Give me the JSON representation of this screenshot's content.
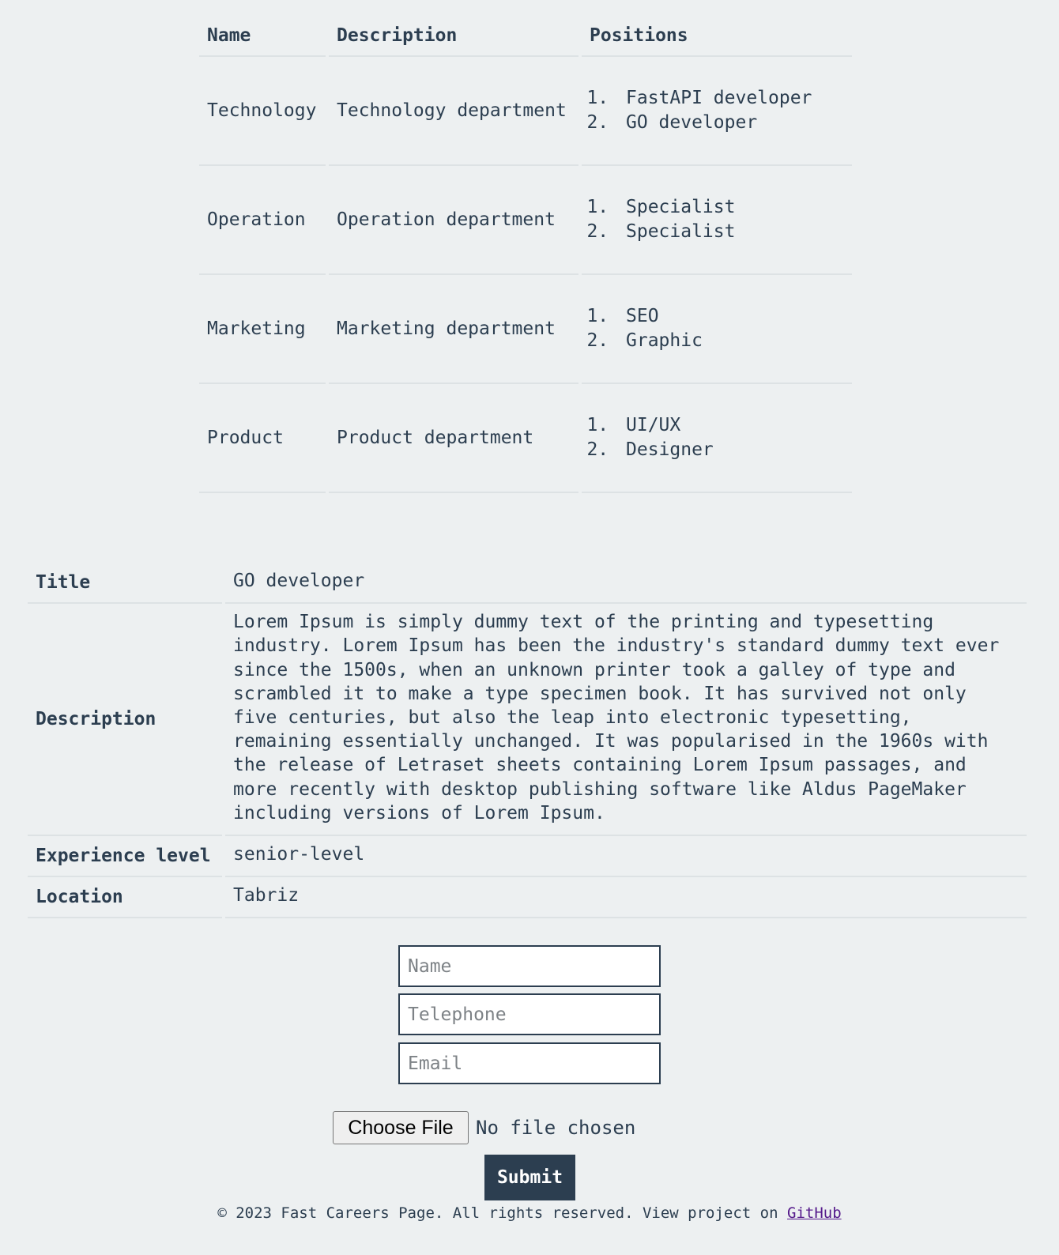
{
  "departments": {
    "headers": {
      "name": "Name",
      "description": "Description",
      "positions": "Positions"
    },
    "rows": [
      {
        "name": "Technology",
        "description": "Technology department",
        "positions": [
          "FastAPI developer",
          "GO developer"
        ]
      },
      {
        "name": "Operation",
        "description": "Operation department",
        "positions": [
          "Specialist",
          "Specialist"
        ]
      },
      {
        "name": "Marketing",
        "description": "Marketing department",
        "positions": [
          "SEO",
          "Graphic"
        ]
      },
      {
        "name": "Product",
        "description": "Product department",
        "positions": [
          "UI/UX",
          "Designer"
        ]
      }
    ]
  },
  "job": {
    "title_label": "Title",
    "title_value": "GO developer",
    "description_label": "Description",
    "description_value": "Lorem Ipsum is simply dummy text of the printing and typesetting industry. Lorem Ipsum has been the industry's standard dummy text ever since the 1500s, when an unknown printer took a galley of type and scrambled it to make a type specimen book. It has survived not only five centuries, but also the leap into electronic typesetting, remaining essentially unchanged. It was popularised in the 1960s with the release of Letraset sheets containing Lorem Ipsum passages, and more recently with desktop publishing software like Aldus PageMaker including versions of Lorem Ipsum.",
    "experience_label": "Experience level",
    "experience_value": "senior-level",
    "location_label": "Location",
    "location_value": "Tabriz"
  },
  "form": {
    "name_placeholder": "Name",
    "telephone_placeholder": "Telephone",
    "email_placeholder": "Email",
    "file_button_label": "Choose File",
    "file_status": "No file chosen",
    "submit_label": "Submit"
  },
  "footer": {
    "text": "© 2023 Fast Careers Page. All rights reserved. View project on ",
    "link_label": "GitHub"
  },
  "colors": {
    "text": "#2c3e50",
    "background": "#edf0f1",
    "submit_background": "#2c3e50",
    "link": "#551a8b"
  }
}
